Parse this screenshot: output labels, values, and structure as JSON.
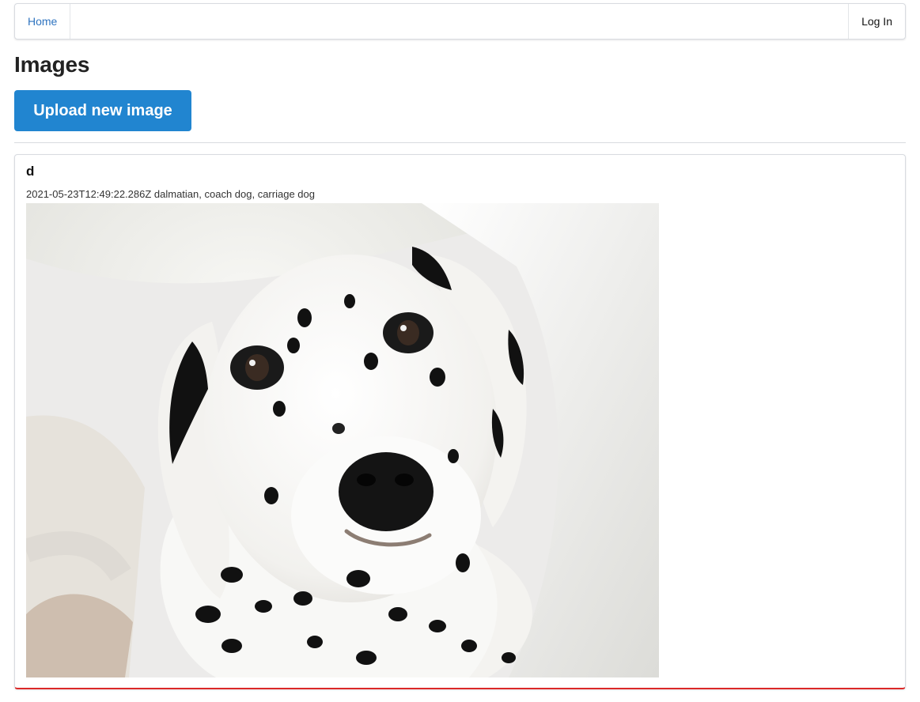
{
  "nav": {
    "home_label": "Home",
    "login_label": "Log In"
  },
  "page": {
    "title": "Images",
    "upload_button_label": "Upload new image"
  },
  "images": [
    {
      "title": "d",
      "meta": "2021-05-23T12:49:22.286Z dalmatian, coach dog, carriage dog",
      "image_subject": "dalmatian puppy photo"
    }
  ],
  "colors": {
    "link": "#2f74c0",
    "primary_button": "#2185d0",
    "card_bottom_border": "#db2828"
  }
}
